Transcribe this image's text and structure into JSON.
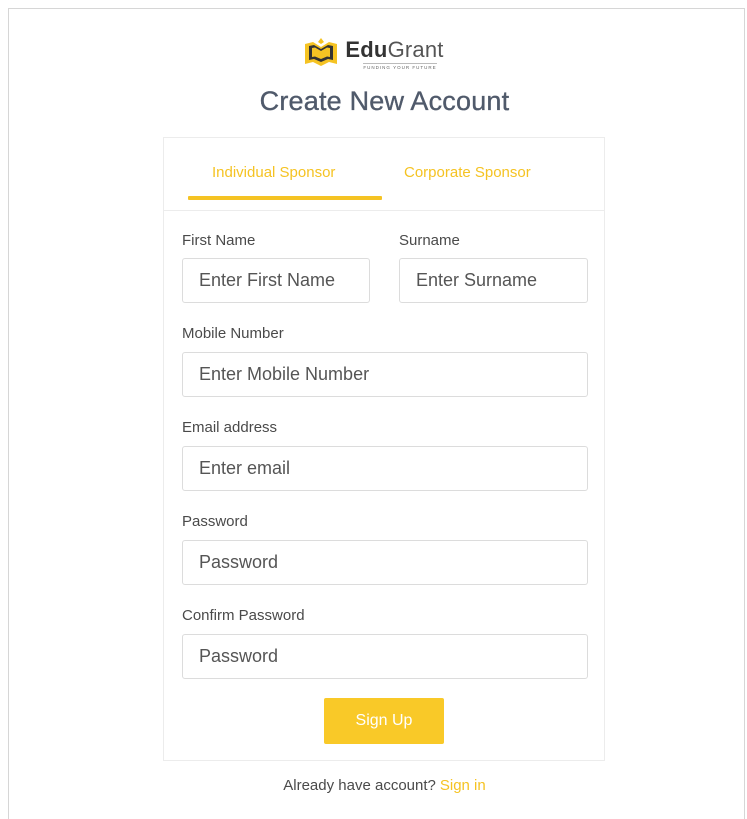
{
  "brand": {
    "name_bold": "Edu",
    "name_light": "Grant",
    "tagline": "FUNDING YOUR FUTURE",
    "accent_color": "#f5c323",
    "logo_icon": "open-book-icon"
  },
  "page": {
    "title": "Create New Account"
  },
  "tabs": [
    {
      "label": "Individual Sponsor",
      "active": true
    },
    {
      "label": "Corporate Sponsor",
      "active": false
    }
  ],
  "form": {
    "first_name": {
      "label": "First Name",
      "placeholder": "Enter First Name",
      "value": ""
    },
    "surname": {
      "label": "Surname",
      "placeholder": "Enter Surname",
      "value": ""
    },
    "mobile": {
      "label": "Mobile Number",
      "placeholder": "Enter Mobile Number",
      "value": ""
    },
    "email": {
      "label": "Email address",
      "placeholder": "Enter email",
      "value": ""
    },
    "password": {
      "label": "Password",
      "placeholder": "Password",
      "value": ""
    },
    "confirm_password": {
      "label": "Confirm Password",
      "placeholder": "Password",
      "value": ""
    },
    "submit_label": "Sign Up"
  },
  "footer": {
    "prompt": "Already have account?",
    "signin_label": "Sign in"
  }
}
